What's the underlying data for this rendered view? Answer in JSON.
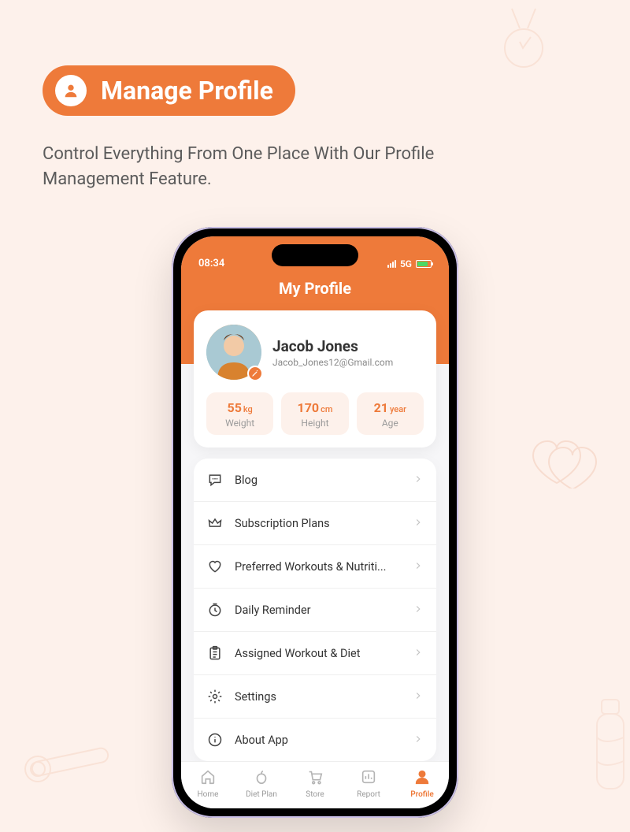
{
  "header": {
    "title": "Manage Profile",
    "subtitle": "Control Everything From One Place With Our Profile Management Feature."
  },
  "status": {
    "time": "08:34",
    "network": "5G"
  },
  "app_header": {
    "title": "My Profile"
  },
  "profile": {
    "name": "Jacob Jones",
    "email": "Jacob_Jones12@Gmail.com"
  },
  "stats": [
    {
      "value": "55",
      "unit": "kg",
      "label": "Weight"
    },
    {
      "value": "170",
      "unit": "cm",
      "label": "Height"
    },
    {
      "value": "21",
      "unit": "year",
      "label": "Age"
    }
  ],
  "menu": [
    {
      "icon": "chat-icon",
      "label": "Blog"
    },
    {
      "icon": "crown-icon",
      "label": "Subscription Plans"
    },
    {
      "icon": "heart-icon",
      "label": "Preferred Workouts & Nutriti..."
    },
    {
      "icon": "clock-icon",
      "label": "Daily Reminder"
    },
    {
      "icon": "clipboard-icon",
      "label": "Assigned Workout & Diet"
    },
    {
      "icon": "gear-icon",
      "label": "Settings"
    },
    {
      "icon": "info-icon",
      "label": "About App"
    }
  ],
  "tabs": [
    {
      "icon": "home-icon",
      "label": "Home",
      "active": false
    },
    {
      "icon": "apple-icon",
      "label": "Diet Plan",
      "active": false
    },
    {
      "icon": "cart-icon",
      "label": "Store",
      "active": false
    },
    {
      "icon": "chart-icon",
      "label": "Report",
      "active": false
    },
    {
      "icon": "person-icon",
      "label": "Profile",
      "active": true
    }
  ]
}
